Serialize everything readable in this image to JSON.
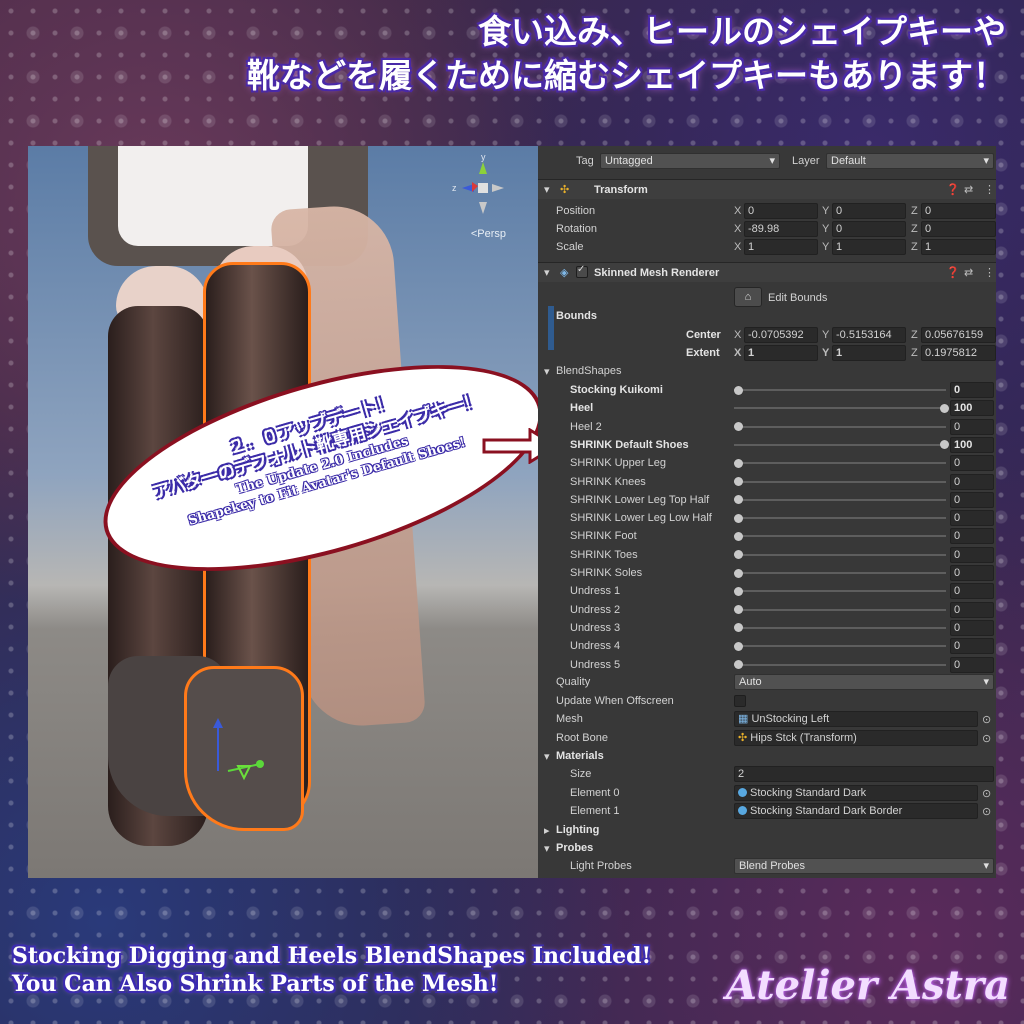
{
  "headline": {
    "line1": "食い込み、ヒールのシェイプキーや",
    "line2": "靴などを履くために縮むシェイプキーもあります！"
  },
  "footer": {
    "line1": "Stocking Digging and Heels BlendShapes Included!",
    "line2": "You Can Also Shrink Parts of the Mesh!"
  },
  "brand": "Atelier Astra",
  "scene": {
    "persp_label": "<Persp",
    "gizmo": {
      "y": "y",
      "z": "z"
    }
  },
  "callout": {
    "jp1": "２．０アップデート！",
    "jp2": "アバターのデフォルト靴専用シェイプキー！",
    "en1": "The Update 2.0 Includes",
    "en2": "Shapekey to Fit Avatar's Default Shoes!"
  },
  "inspector": {
    "tag_label": "Tag",
    "tag_value": "Untagged",
    "layer_label": "Layer",
    "layer_value": "Default",
    "transform": {
      "title": "Transform",
      "position_label": "Position",
      "rotation_label": "Rotation",
      "scale_label": "Scale",
      "position": {
        "x": "0",
        "y": "0",
        "z": "0"
      },
      "rotation": {
        "x": "-89.98",
        "y": "0",
        "z": "0"
      },
      "scale": {
        "x": "1",
        "y": "1",
        "z": "1"
      }
    },
    "smr": {
      "title": "Skinned Mesh Renderer",
      "edit_bounds": "Edit Bounds",
      "bounds_label": "Bounds",
      "center_label": "Center",
      "extent_label": "Extent",
      "center": {
        "x": "-0.0705392",
        "y": "-0.5153164",
        "z": "0.05676159"
      },
      "extent": {
        "x": "1",
        "y": "1",
        "z": "0.1975812"
      },
      "blendshapes_label": "BlendShapes",
      "blendshapes": [
        {
          "name": "Stocking Kuikomi",
          "value": "0",
          "bold": true
        },
        {
          "name": "Heel",
          "value": "100",
          "bold": true
        },
        {
          "name": "Heel 2",
          "value": "0",
          "bold": false
        },
        {
          "name": "SHRINK Default Shoes",
          "value": "100",
          "bold": true
        },
        {
          "name": "SHRINK Upper Leg",
          "value": "0",
          "bold": false
        },
        {
          "name": "SHRINK Knees",
          "value": "0",
          "bold": false
        },
        {
          "name": "SHRINK Lower Leg Top Half",
          "value": "0",
          "bold": false
        },
        {
          "name": "SHRINK Lower Leg Low Half",
          "value": "0",
          "bold": false
        },
        {
          "name": "SHRINK Foot",
          "value": "0",
          "bold": false
        },
        {
          "name": "SHRINK Toes",
          "value": "0",
          "bold": false
        },
        {
          "name": "SHRINK Soles",
          "value": "0",
          "bold": false
        },
        {
          "name": "Undress 1",
          "value": "0",
          "bold": false
        },
        {
          "name": "Undress 2",
          "value": "0",
          "bold": false
        },
        {
          "name": "Undress 3",
          "value": "0",
          "bold": false
        },
        {
          "name": "Undress 4",
          "value": "0",
          "bold": false
        },
        {
          "name": "Undress 5",
          "value": "0",
          "bold": false
        }
      ],
      "quality_label": "Quality",
      "quality_value": "Auto",
      "offscreen_label": "Update When Offscreen",
      "mesh_label": "Mesh",
      "mesh_value": "UnStocking Left",
      "rootbone_label": "Root Bone",
      "rootbone_value": "Hips Stck (Transform)",
      "materials_label": "Materials",
      "size_label": "Size",
      "size_value": "2",
      "element0_label": "Element 0",
      "element0_value": "Stocking Standard Dark",
      "element1_label": "Element 1",
      "element1_value": "Stocking Standard Dark Border",
      "lighting_label": "Lighting",
      "probes_label": "Probes",
      "lightprobes_label": "Light Probes",
      "lightprobes_value": "Blend Probes"
    }
  },
  "colors": {
    "accent_orange": "#ff7a1a",
    "callout_border": "#8a1020",
    "text_outline": "#3b2ba8"
  }
}
